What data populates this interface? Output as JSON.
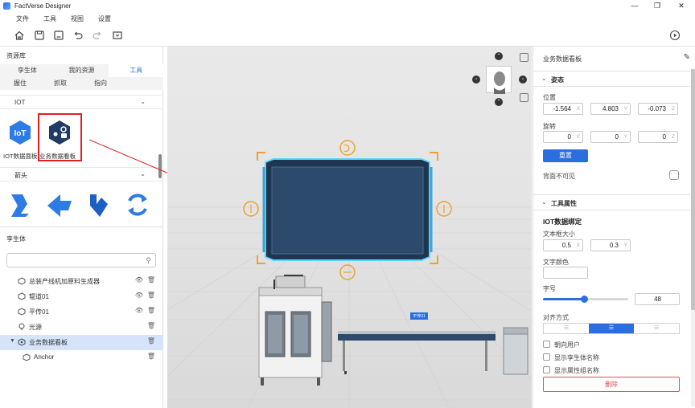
{
  "app": {
    "title": "FactVerse Designer"
  },
  "window_controls": {
    "minimize": "—",
    "maximize": "❐",
    "close": "✕"
  },
  "menu": [
    "文件",
    "工具",
    "视图",
    "设置"
  ],
  "toolbar": {
    "icons": [
      "home-icon",
      "save-icon",
      "save-as-icon",
      "undo-icon",
      "redo-icon",
      "screenshot-icon",
      "play-icon"
    ]
  },
  "left_panel": {
    "title": "资源库",
    "tabs": [
      "孪生体",
      "我的资源",
      "工具"
    ],
    "active_tab": "工具",
    "subtabs": [
      "握住",
      "抓取",
      "指向"
    ],
    "category_iot": "IOT",
    "iot_items": [
      "IOT数据面板",
      "业务数据看板"
    ],
    "category_arrow": "箭头",
    "twin_section": "孪生体",
    "search": {
      "placeholder": ""
    },
    "tree": [
      {
        "label": "总装产线机加原料生成器",
        "eye": true,
        "selected": false
      },
      {
        "label": "辊道01",
        "eye": true,
        "selected": false
      },
      {
        "label": "平传01",
        "eye": true,
        "selected": false
      },
      {
        "label": "光源",
        "eye": false,
        "selected": false
      },
      {
        "label": "业务数据看板",
        "eye": false,
        "selected": true
      },
      {
        "label": "Anchor",
        "eye": false,
        "selected": false
      }
    ]
  },
  "viewport": {
    "tag_label": "平传01"
  },
  "right_panel": {
    "title": "业务数据看板",
    "pose_section": "姿态",
    "position_label": "位置",
    "position": {
      "x": "-1.564",
      "y": "4.803",
      "z": "-0.073"
    },
    "rotation_label": "旋转",
    "rotation": {
      "x": "0",
      "y": "0",
      "z": "0"
    },
    "axis": {
      "x": "X",
      "y": "Y",
      "z": "Z"
    },
    "reset_button": "重置",
    "backface_label": "背面不可见",
    "tool_section": "工具属性",
    "iot_binding": "IOT数据绑定",
    "textbox_size_label": "文本框大小",
    "textbox_size": {
      "x": "0.5",
      "y": "0.3"
    },
    "text_color_label": "文字颜色",
    "font_size_label": "字号",
    "font_size": "48",
    "font_size_fraction": 0.48,
    "align_label": "对齐方式",
    "align_options": [
      "☰",
      "☰",
      "☰"
    ],
    "align_selected": 1,
    "checkbox_face_user": "朝向用户",
    "checkbox_show_twin_name": "显示孪生体名称",
    "checkbox_show_group_name": "显示属性组名称",
    "delete_button": "删除"
  },
  "colors": {
    "accent": "#2b6fde",
    "screen_fill": "#2c4a6b",
    "screen_glow": "#59d6ff",
    "gizmo": "#f0a030",
    "delete": "#e05050",
    "selection_red": "#e02020"
  }
}
